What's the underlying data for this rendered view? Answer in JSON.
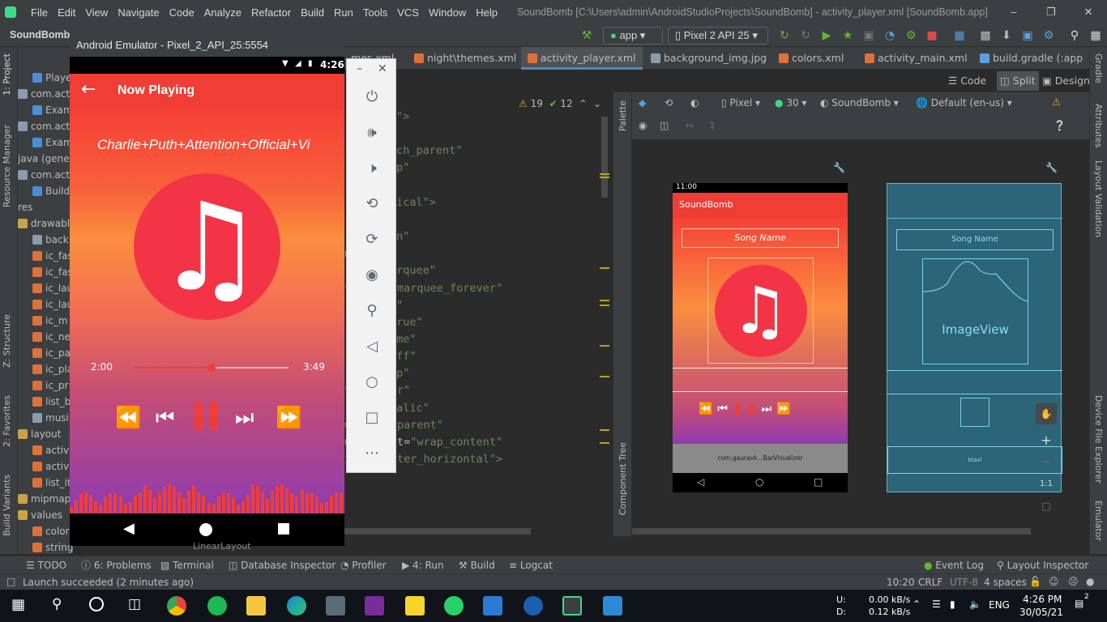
{
  "menu": {
    "items": [
      "File",
      "Edit",
      "View",
      "Navigate",
      "Code",
      "Analyze",
      "Refactor",
      "Build",
      "Run",
      "Tools",
      "VCS",
      "Window",
      "Help"
    ],
    "title": "SoundBomb [C:\\Users\\admin\\AndroidStudioProjects\\SoundBomb] - activity_player.xml [SoundBomb.app]"
  },
  "toolbar": {
    "project": "SoundBomb",
    "run_config": "app",
    "device": "Pixel 2 API 25"
  },
  "emulator": {
    "title": "Android Emulator - Pixel_2_API_25:5554",
    "time": "4:26",
    "app_title": "Now Playing",
    "song": "Charlie+Puth+Attention+Official+Vi",
    "elapsed": "2:00",
    "duration": "3:49",
    "progress": 0.5
  },
  "left_strip": {
    "project": "1: Project",
    "resource": "Resource Manager",
    "structure": "Z: Structure",
    "favorites": "2: Favorites",
    "build_variants": "Build Variants"
  },
  "project_tree": [
    {
      "label": "Playe",
      "indent": 18,
      "color": "#4a8fd6"
    },
    {
      "label": "com.act",
      "indent": 0,
      "color": "#8a9bb0"
    },
    {
      "label": "Exam",
      "indent": 18,
      "color": "#4a8fd6"
    },
    {
      "label": "com.act",
      "indent": 0,
      "color": "#8a9bb0"
    },
    {
      "label": "Exam",
      "indent": 18,
      "color": "#4a8fd6"
    },
    {
      "label": "java (genera",
      "indent": 0,
      "color": ""
    },
    {
      "label": "com.act",
      "indent": 0,
      "color": "#8a9bb0"
    },
    {
      "label": "Build",
      "indent": 18,
      "color": "#4a8fd6"
    },
    {
      "label": "res",
      "indent": 0,
      "color": ""
    },
    {
      "label": "drawabl",
      "indent": 0,
      "color": "#c9a24b"
    },
    {
      "label": "back",
      "indent": 18,
      "color": "#8a9bb0"
    },
    {
      "label": "ic_fas",
      "indent": 18,
      "color": "#e0703a"
    },
    {
      "label": "ic_fas",
      "indent": 18,
      "color": "#e0703a"
    },
    {
      "label": "ic_lau",
      "indent": 18,
      "color": "#e0703a"
    },
    {
      "label": "ic_lau",
      "indent": 18,
      "color": "#e0703a"
    },
    {
      "label": "ic_m",
      "indent": 18,
      "color": "#e0703a"
    },
    {
      "label": "ic_ne",
      "indent": 18,
      "color": "#e0703a"
    },
    {
      "label": "ic_pa",
      "indent": 18,
      "color": "#e0703a"
    },
    {
      "label": "ic_pla",
      "indent": 18,
      "color": "#e0703a"
    },
    {
      "label": "ic_pr",
      "indent": 18,
      "color": "#e0703a"
    },
    {
      "label": "list_b",
      "indent": 18,
      "color": "#e0703a"
    },
    {
      "label": "musi",
      "indent": 18,
      "color": "#8a9bb0"
    },
    {
      "label": "layout",
      "indent": 0,
      "color": "#c9a24b"
    },
    {
      "label": "activ",
      "indent": 18,
      "color": "#e0703a"
    },
    {
      "label": "activ",
      "indent": 18,
      "color": "#e0703a"
    },
    {
      "label": "list_it",
      "indent": 18,
      "color": "#e0703a"
    },
    {
      "label": "mipmap",
      "indent": 0,
      "color": "#c9a24b"
    },
    {
      "label": "values",
      "indent": 0,
      "color": "#c9a24b"
    },
    {
      "label": "color",
      "indent": 18,
      "color": "#e0703a"
    },
    {
      "label": "strings.xml",
      "indent": 18,
      "color": "#e0703a"
    }
  ],
  "editor_tabs": [
    "mes.xml",
    "night\\themes.xml",
    "activity_player.xml",
    "background_img.jpg",
    "colors.xml",
    "activity_main.xml",
    "build.gradle (:app"
  ],
  "view_modes": {
    "code": "Code",
    "split": "Split",
    "design": "Design"
  },
  "inspection": {
    "warnings": "19",
    "weak": "12"
  },
  "code_lines": [
    {
      "pre": "",
      "str": "y\">",
      "post": ""
    },
    {
      "pre": "",
      "str": "",
      "post": ""
    },
    {
      "pre": "",
      "str": "tch_parent\"",
      "post": ""
    },
    {
      "pre": "",
      "str": "dp\"",
      "post": ""
    },
    {
      "pre": "",
      "str": "\"",
      "post": ""
    },
    {
      "pre": "",
      "str": "tical\">",
      "post": ""
    },
    {
      "pre": "",
      "str": "",
      "post": ""
    },
    {
      "pre": "",
      "str": "sn\"",
      "post": ""
    },
    {
      "pre": "n=",
      "str": "\"20dp\"",
      "post": ""
    },
    {
      "pre": "",
      "str": "arquee\"",
      "post": ""
    },
    {
      "pre": "tLimit=",
      "str": "\"marquee_forever\"",
      "post": ""
    },
    {
      "pre": "",
      "str": "p\"",
      "post": ""
    },
    {
      "pre": "",
      "str": "true\"",
      "post": ""
    },
    {
      "pre": "",
      "str": "ame\"",
      "post": ""
    },
    {
      "pre": "",
      "str": "fff\"",
      "post": ""
    },
    {
      "pre": "",
      "str": "dp\"",
      "post": ""
    },
    {
      "pre": "t=",
      "str": "\"center\"",
      "post": ""
    },
    {
      "pre": "",
      "str": "talic\"",
      "post": ""
    },
    {
      "pre": "=",
      "str": "\"match_parent\"",
      "post": ""
    },
    {
      "pre": "ut_height=",
      "str": "\"wrap_content\"",
      "post": ""
    },
    {
      "pre": "ity=",
      "str": "\"center_horizontal\">",
      "post": ""
    }
  ],
  "design_toolbar": {
    "device": "Pixel",
    "api": "30",
    "theme": "SoundBomb",
    "locale": "Default (en-us)"
  },
  "palette_label": "Palette",
  "component_tree_label": "Component Tree",
  "right_strip": {
    "gradle": "Gradle",
    "attributes": "Attributes",
    "validation": "Layout Validation",
    "device_file": "Device File Explorer",
    "emulator": "Emulator"
  },
  "design": {
    "time": "11:00",
    "app_name": "SoundBomb",
    "song_name": "Song Name",
    "bar_visualizer": "com.gauravk...BarVisualizer",
    "imageview": "ImageView",
    "blaxl": "blaxl",
    "zoom_label": "1:1"
  },
  "legacy_text": "LinearLayout",
  "bottom_tabs": [
    "TODO",
    "6: Problems",
    "Terminal",
    "Database Inspector",
    "Profiler",
    "4: Run",
    "Build",
    "Logcat",
    "Event Log",
    "Layout Inspector"
  ],
  "status": {
    "message": "Launch succeeded (2 minutes ago)",
    "pos": "10:20",
    "crlf": "CRLF",
    "enc": "UTF-8",
    "indent": "4 spaces"
  },
  "taskbar": {
    "net_up_label": "U:",
    "net_down_label": "D:",
    "net_up": "0.00 kB/s",
    "net_down": "0.12 kB/s",
    "lang": "ENG",
    "time": "4:26 PM",
    "date": "30/05/21",
    "notif": "2"
  },
  "colors": {
    "accent": "#f03e36",
    "android_green": "#3ddc84"
  }
}
